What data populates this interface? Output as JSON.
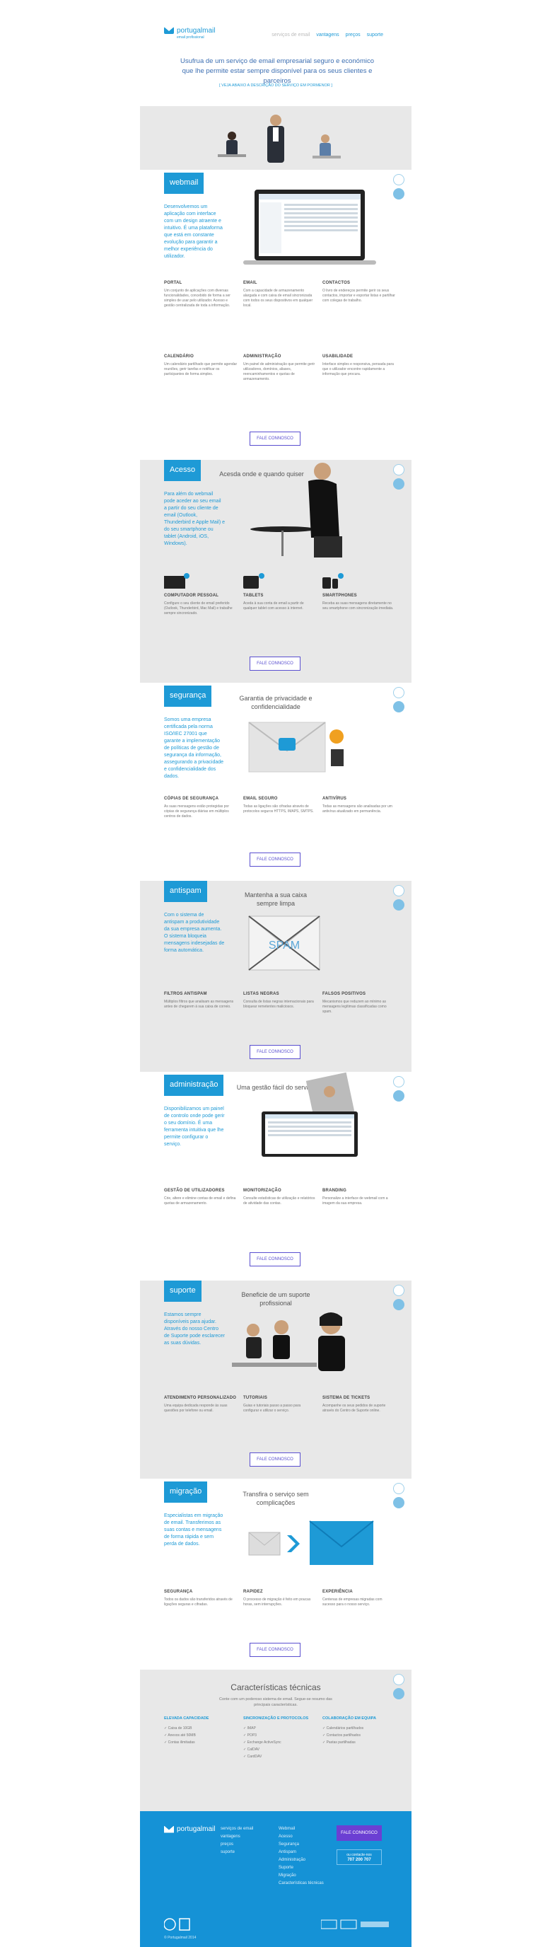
{
  "header": {
    "logo_name": "portugalmail",
    "logo_sub": "email profissional",
    "nav": [
      "serviços de email",
      "vantagens",
      "preços",
      "suporte"
    ],
    "intro": "Usufrua de um serviço de email empresarial seguro e económico que lhe permite estar sempre disponível para os seus clientes e parceiros",
    "intro_link": "[ VEJA ABAIXO A DESCRIÇÃO DO SERVIÇO EM PORMENOR ]"
  },
  "sections": {
    "webmail": {
      "tag": "webmail",
      "lead": "Desenvolvemos um aplicação com interface com um design atraente e intuitivo. É uma plataforma que está em constante evolução para garantir a melhor experiência do utilizador.",
      "features": [
        {
          "title": "PORTAL",
          "text": "Um conjunto de aplicações com diversas funcionalidades, concebido de forma a ser simples de usar pelo utilizador. Acesso e gestão centralizada de toda a informação."
        },
        {
          "title": "EMAIL",
          "text": "Com a capacidade de armazenamento alargada e com caixa de email sincronizada com todos os seus dispositivos em qualquer local."
        },
        {
          "title": "CONTACTOS",
          "text": "O livro de endereços permite gerir os seus contactos, importar e exportar listas e partilhar com colegas de trabalho."
        },
        {
          "title": "CALENDÁRIO",
          "text": "Um calendário partilhado que permite agendar reuniões, gerir tarefas e notificar os participantes de forma simples."
        },
        {
          "title": "ADMINISTRAÇÃO",
          "text": "Um painel de administração que permite gerir utilizadores, domínios, aliases, reencaminhamentos e quotas de armazenamento."
        },
        {
          "title": "USABILIDADE",
          "text": "Interface simples e responsiva, pensada para que o utilizador encontre rapidamente a informação que procura."
        }
      ],
      "cta": "FALE CONNOSCO"
    },
    "acesso": {
      "tag": "Acesso",
      "headline": "Acesda onde e quando quiser",
      "lead": "Para além do webmail pode aceder ao seu email a partir do seu cliente de email (Outlook, Thunderbird e Apple Mail) e do seu smartphone ou tablet (Android, iOS, Windows).",
      "features": [
        {
          "title": "COMPUTADOR PESSOAL",
          "text": "Configure o seu cliente de email preferido (Outlook, Thunderbird, Mac Mail) e trabalhe sempre sincronizado."
        },
        {
          "title": "TABLETS",
          "text": "Aceda à sua conta de email a partir de qualquer tablet com acesso à internet."
        },
        {
          "title": "SMARTPHONES",
          "text": "Receba as suas mensagens diretamente no seu smartphone com sincronização imediata."
        }
      ],
      "cta": "FALE CONNOSCO"
    },
    "seguranca": {
      "tag": "segurança",
      "headline": "Garantia de privacidade e confidencialidade",
      "lead": "Somos uma empresa certificada pela norma ISO/IEC 27001 que garante a implementação de políticas de gestão de segurança da informação, assegurando a privacidade e confidencialidade dos dados.",
      "features": [
        {
          "title": "CÓPIAS DE SEGURANÇA",
          "text": "As suas mensagens estão protegidas por cópias de segurança diárias em múltiplos centros de dados."
        },
        {
          "title": "EMAIL SEGURO",
          "text": "Todas as ligações são cifradas através de protocolos seguros HTTPS, IMAPS, SMTPS."
        },
        {
          "title": "ANTIVÍRUS",
          "text": "Todas as mensagens são analisadas por um antivírus atualizado em permanência."
        }
      ],
      "cta": "FALE CONNOSCO"
    },
    "antispam": {
      "tag": "antispam",
      "headline": "Mantenha a sua caixa sempre limpa",
      "lead": "Com o sistema de antispam a produtividade da sua empresa aumenta. O sistema bloqueia mensagens indesejadas de forma automática.",
      "image_label": "SPAM",
      "features": [
        {
          "title": "FILTROS ANTISPAM",
          "text": "Múltiplos filtros que analisam as mensagens antes de chegarem à sua caixa de correio."
        },
        {
          "title": "LISTAS NEGRAS",
          "text": "Consulta de listas negras internacionais para bloquear remetentes maliciosos."
        },
        {
          "title": "FALSOS POSITIVOS",
          "text": "Mecanismos que reduzem ao mínimo as mensagens legítimas classificadas como spam."
        }
      ],
      "cta": "FALE CONNOSCO"
    },
    "administracao": {
      "tag": "administração",
      "headline": "Uma gestão fácil do serviço",
      "lead": "Disponibilizamos um painel de controlo onde pode gerir o seu domínio. É uma ferramenta intuitiva que lhe permite configurar o serviço.",
      "features": [
        {
          "title": "GESTÃO DE UTILIZADORES",
          "text": "Crie, altere e elimine contas de email e defina quotas de armazenamento."
        },
        {
          "title": "MONITORIZAÇÃO",
          "text": "Consulte estatísticas de utilização e relatórios de atividade das contas."
        },
        {
          "title": "BRANDING",
          "text": "Personalize a interface de webmail com a imagem da sua empresa."
        }
      ],
      "cta": "FALE CONNOSCO"
    },
    "suporte": {
      "tag": "suporte",
      "headline": "Beneficie de um suporte profissional",
      "lead": "Estamos sempre disponíveis para ajudar. Através do nosso Centro de Suporte pode esclarecer as suas dúvidas.",
      "features": [
        {
          "title": "ATENDIMENTO PERSONALIZADO",
          "text": "Uma equipa dedicada responde às suas questões por telefone ou email."
        },
        {
          "title": "TUTORIAIS",
          "text": "Guias e tutoriais passo a passo para configurar e utilizar o serviço."
        },
        {
          "title": "SISTEMA DE TICKETS",
          "text": "Acompanhe os seus pedidos de suporte através do Centro de Suporte online."
        }
      ],
      "cta": "FALE CONNOSCO"
    },
    "migracao": {
      "tag": "migração",
      "headline": "Transfira o serviço sem complicações",
      "lead": "Especialistas em migração de email. Transferimos as suas contas e mensagens de forma rápida e sem perda de dados.",
      "features": [
        {
          "title": "SEGURANÇA",
          "text": "Todos os dados são transferidos através de ligações seguras e cifradas."
        },
        {
          "title": "RAPIDEZ",
          "text": "O processo de migração é feito em poucas horas, sem interrupções."
        },
        {
          "title": "EXPERIÊNCIA",
          "text": "Centenas de empresas migradas com sucesso para o nosso serviço."
        }
      ],
      "cta": "FALE CONNOSCO"
    }
  },
  "tech": {
    "title": "Características técnicas",
    "subtitle": "Conte com um poderoso sistema de email. Segue-se resumo das principais características.",
    "cols": [
      {
        "title": "ELEVADA CAPACIDADE",
        "items": [
          "Caixa de 10GB",
          "Anexos até 50MB",
          "Contas ilimitadas"
        ]
      },
      {
        "title": "SINCRONIZAÇÃO E PROTOCOLOS",
        "items": [
          "IMAP",
          "POP3",
          "Exchange ActiveSync",
          "CalDAV",
          "CardDAV"
        ]
      },
      {
        "title": "COLABORAÇÃO EM EQUIPA",
        "items": [
          "Calendários partilhados",
          "Contactos partilhados",
          "Pastas partilhadas"
        ]
      }
    ]
  },
  "footer": {
    "logo": "portugalmail",
    "col1": [
      "serviços de email",
      "vantagens",
      "preços",
      "suporte"
    ],
    "col2": [
      "Webmail",
      "Acesso",
      "Segurança",
      "Antispam",
      "Administração",
      "Suporte",
      "Migração",
      "Características técnicas"
    ],
    "cta": "FALE CONNOSCO",
    "phone_label": "ou contacte-nos",
    "phone": "707 200 707",
    "copyright": "© Portugalmail 2014"
  },
  "colors": {
    "accent": "#1e9ad6",
    "cta": "#5a4fd0",
    "footer": "#1592d6",
    "grey": "#e8e8e8"
  }
}
